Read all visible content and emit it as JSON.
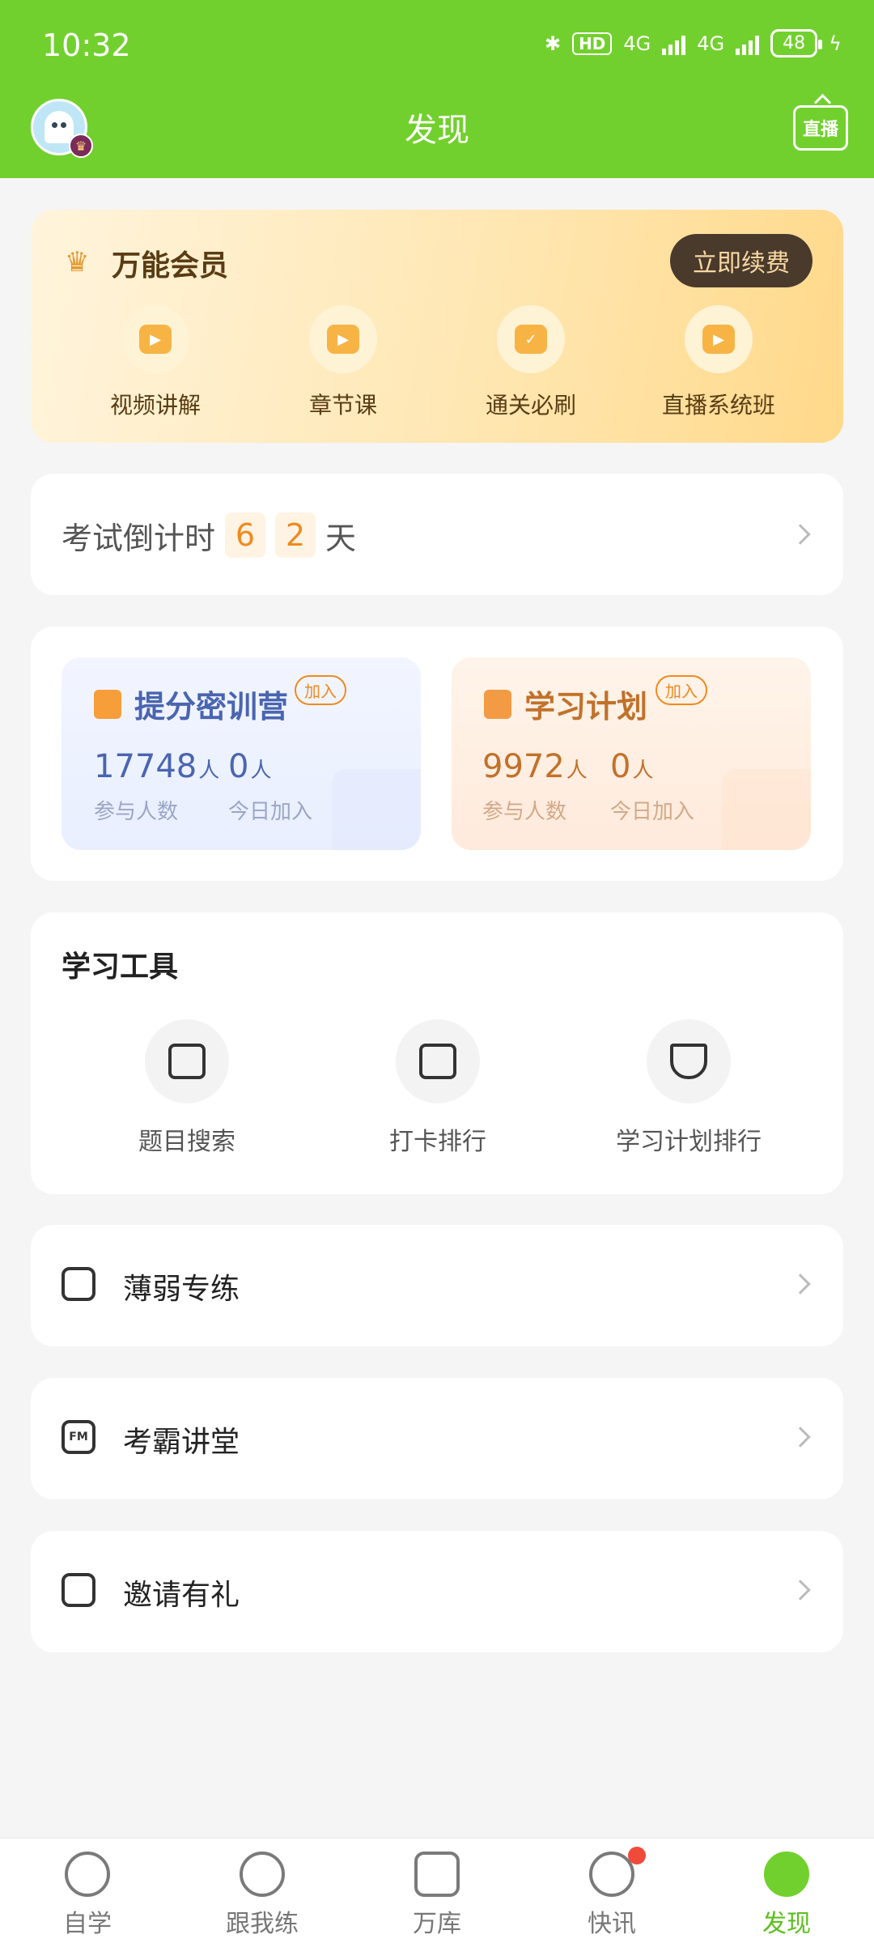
{
  "status_bar": {
    "time": "10:32",
    "hd": "HD",
    "net1": "4G",
    "net2": "4G",
    "battery": "48"
  },
  "header": {
    "title": "发现",
    "live_label": "直播"
  },
  "vip": {
    "title": "万能会员",
    "renew_label": "立即续费",
    "features": [
      {
        "label": "视频讲解",
        "icon": "play-screen-icon"
      },
      {
        "label": "章节课",
        "icon": "play-book-icon"
      },
      {
        "label": "通关必刷",
        "icon": "check-doc-icon"
      },
      {
        "label": "直播系统班",
        "icon": "tv-play-icon"
      }
    ]
  },
  "countdown": {
    "prefix": "考试倒计时",
    "digits": [
      "6",
      "2"
    ],
    "suffix": "天"
  },
  "camps": [
    {
      "title": "提分密训营",
      "join": "加入",
      "participants": "17748",
      "participants_unit": "人",
      "participants_label": "参与人数",
      "today": "0",
      "today_unit": "人",
      "today_label": "今日加入"
    },
    {
      "title": "学习计划",
      "join": "加入",
      "participants": "9972",
      "participants_unit": "人",
      "participants_label": "参与人数",
      "today": "0",
      "today_unit": "人",
      "today_label": "今日加入"
    }
  ],
  "tools": {
    "title": "学习工具",
    "items": [
      {
        "label": "题目搜索",
        "icon": "search-list-icon"
      },
      {
        "label": "打卡排行",
        "icon": "calendar-chart-icon"
      },
      {
        "label": "学习计划排行",
        "icon": "trophy-icon"
      }
    ]
  },
  "entries": [
    {
      "label": "薄弱专练",
      "icon": "robot-face-icon"
    },
    {
      "label": "考霸讲堂",
      "icon": "fm-radio-icon",
      "icon_text": "FM"
    },
    {
      "label": "邀请有礼",
      "icon": "gift-icon"
    }
  ],
  "bottom_nav": [
    {
      "label": "自学",
      "icon": "pacman-icon"
    },
    {
      "label": "跟我练",
      "icon": "check-circle-icon"
    },
    {
      "label": "万库",
      "icon": "doc-list-icon"
    },
    {
      "label": "快讯",
      "icon": "lightning-icon",
      "badge": true
    },
    {
      "label": "发现",
      "icon": "compass-icon",
      "active": true
    }
  ],
  "colors": {
    "brand_green": "#72d02e",
    "accent_orange": "#f08a1e",
    "badge_red": "#f04a3b"
  }
}
